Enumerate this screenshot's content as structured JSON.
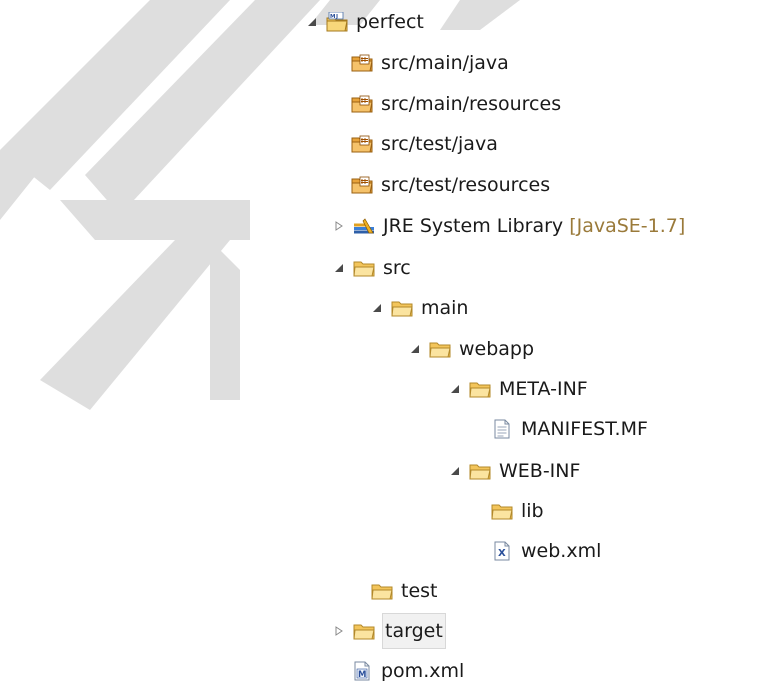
{
  "tree": {
    "items": [
      {
        "label": "perfect",
        "icon": "maven-project-icon",
        "state": "expanded"
      },
      {
        "label": "src/main/java",
        "icon": "source-folder-icon",
        "state": "leaf"
      },
      {
        "label": "src/main/resources",
        "icon": "source-folder-icon",
        "state": "leaf"
      },
      {
        "label": "src/test/java",
        "icon": "source-folder-icon",
        "state": "leaf"
      },
      {
        "label": "src/test/resources",
        "icon": "source-folder-icon",
        "state": "leaf"
      },
      {
        "label": "JRE System Library",
        "decoration": "[JavaSE-1.7]",
        "icon": "library-icon",
        "state": "collapsed"
      },
      {
        "label": "src",
        "icon": "folder-icon",
        "state": "expanded"
      },
      {
        "label": "main",
        "icon": "folder-icon",
        "state": "expanded"
      },
      {
        "label": "webapp",
        "icon": "folder-icon",
        "state": "expanded"
      },
      {
        "label": "META-INF",
        "icon": "folder-icon",
        "state": "expanded"
      },
      {
        "label": "MANIFEST.MF",
        "icon": "text-file-icon",
        "state": "leaf"
      },
      {
        "label": "WEB-INF",
        "icon": "folder-icon",
        "state": "expanded"
      },
      {
        "label": "lib",
        "icon": "folder-icon",
        "state": "leaf"
      },
      {
        "label": "web.xml",
        "icon": "xml-file-icon",
        "state": "leaf"
      },
      {
        "label": "test",
        "icon": "folder-icon",
        "state": "leaf"
      },
      {
        "label": "target",
        "icon": "folder-icon",
        "state": "collapsed",
        "selected": true
      },
      {
        "label": "pom.xml",
        "icon": "maven-pom-icon",
        "state": "leaf"
      }
    ]
  },
  "colors": {
    "folder": "#f3c55b",
    "source_folder": "#e8a33a",
    "text": "#1a1a1a",
    "decoration": "#9a7a3a",
    "watermark": "#d9d9d9"
  }
}
